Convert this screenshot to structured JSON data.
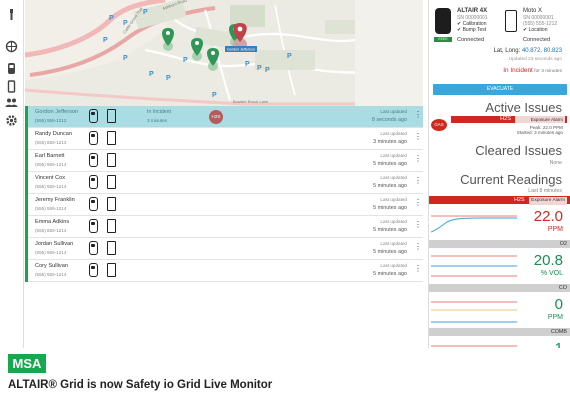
{
  "map": {
    "streets": [
      "Cattle Grove Trail",
      "Ashburn Road",
      "Boulder Brook Lane"
    ],
    "parking_label": "P",
    "selected_label": "Gordon Jefferson"
  },
  "people": [
    {
      "name": "Gordon Jefferson",
      "phone": "(555) 555-1212",
      "status": "In Incident",
      "status_time": "3 minutes",
      "badge": "H2S",
      "updated_label": "Last updated",
      "updated": "8 seconds ago",
      "selected": true
    },
    {
      "name": "Randy Duncan",
      "phone": "(555) 555-1213",
      "updated_label": "Last updated",
      "updated": "3 minutes ago"
    },
    {
      "name": "Earl Barnett",
      "phone": "(555) 555-1214",
      "updated_label": "Last updated",
      "updated": "5 minutes ago"
    },
    {
      "name": "Vincent Cox",
      "phone": "(555) 555-1214",
      "updated_label": "Last updated",
      "updated": "5 minutes ago"
    },
    {
      "name": "Jeremy Franklin",
      "phone": "(555) 555-1214",
      "updated_label": "Last updated",
      "updated": "5 minutes ago"
    },
    {
      "name": "Emma Adkins",
      "phone": "(555) 555-1214",
      "updated_label": "Last updated",
      "updated": "5 minutes ago"
    },
    {
      "name": "Jordan Sullivan",
      "phone": "(555) 555-1214",
      "updated_label": "Last updated",
      "updated": "5 minutes ago"
    },
    {
      "name": "Cory Sullivan",
      "phone": "(555) 555-1214",
      "updated_label": "Last updated",
      "updated": "5 minutes ago"
    }
  ],
  "detail": {
    "device1": {
      "name": "ALTAIR 4X",
      "sn": "SN 00000001",
      "check1": "✔ Calibration",
      "check2": "✔ Bump Test",
      "status": "Connected",
      "tag": "EEEE"
    },
    "device2": {
      "name": "Moto X",
      "sn": "SN 00000001",
      "phone": "(555) 555-1212",
      "check1": "✔ Location",
      "status": "Connected"
    },
    "latlong_label": "Lat, Long:",
    "latlong": "40.872, 80.823",
    "updated": "Updated 23 seconds ago",
    "incident": "In Incident",
    "incident_time": "for 3 minutes",
    "evacuate": "EVACUATE",
    "active_title": "Active Issues",
    "issue": {
      "gas_badge": "GAS",
      "gas": "H2S",
      "alarm": "Exposure Alarm",
      "peak": "Peak: 22.0 PPM",
      "started": "Started: 3 minutes ago"
    },
    "cleared_title": "Cleared Issues",
    "cleared_value": "None",
    "readings_title": "Current Readings",
    "readings_sub": "Last 8 minutes",
    "readings": [
      {
        "gas": "H2S",
        "alarm": "Exposure Alarm",
        "value": "22.0",
        "unit": "PPM",
        "color": "#d0281f",
        "alert": true
      },
      {
        "gas": "O2",
        "value": "20.8",
        "unit": "% VOL",
        "color": "#188f52"
      },
      {
        "gas": "CO",
        "value": "0",
        "unit": "PPM",
        "color": "#188f52"
      },
      {
        "gas": "COMB",
        "value": "1",
        "unit": "",
        "color": "#188f52"
      }
    ]
  },
  "footer": {
    "logo": "MSA",
    "tagline": "ALTAIR® Grid is now Safety io Grid Live Monitor"
  }
}
